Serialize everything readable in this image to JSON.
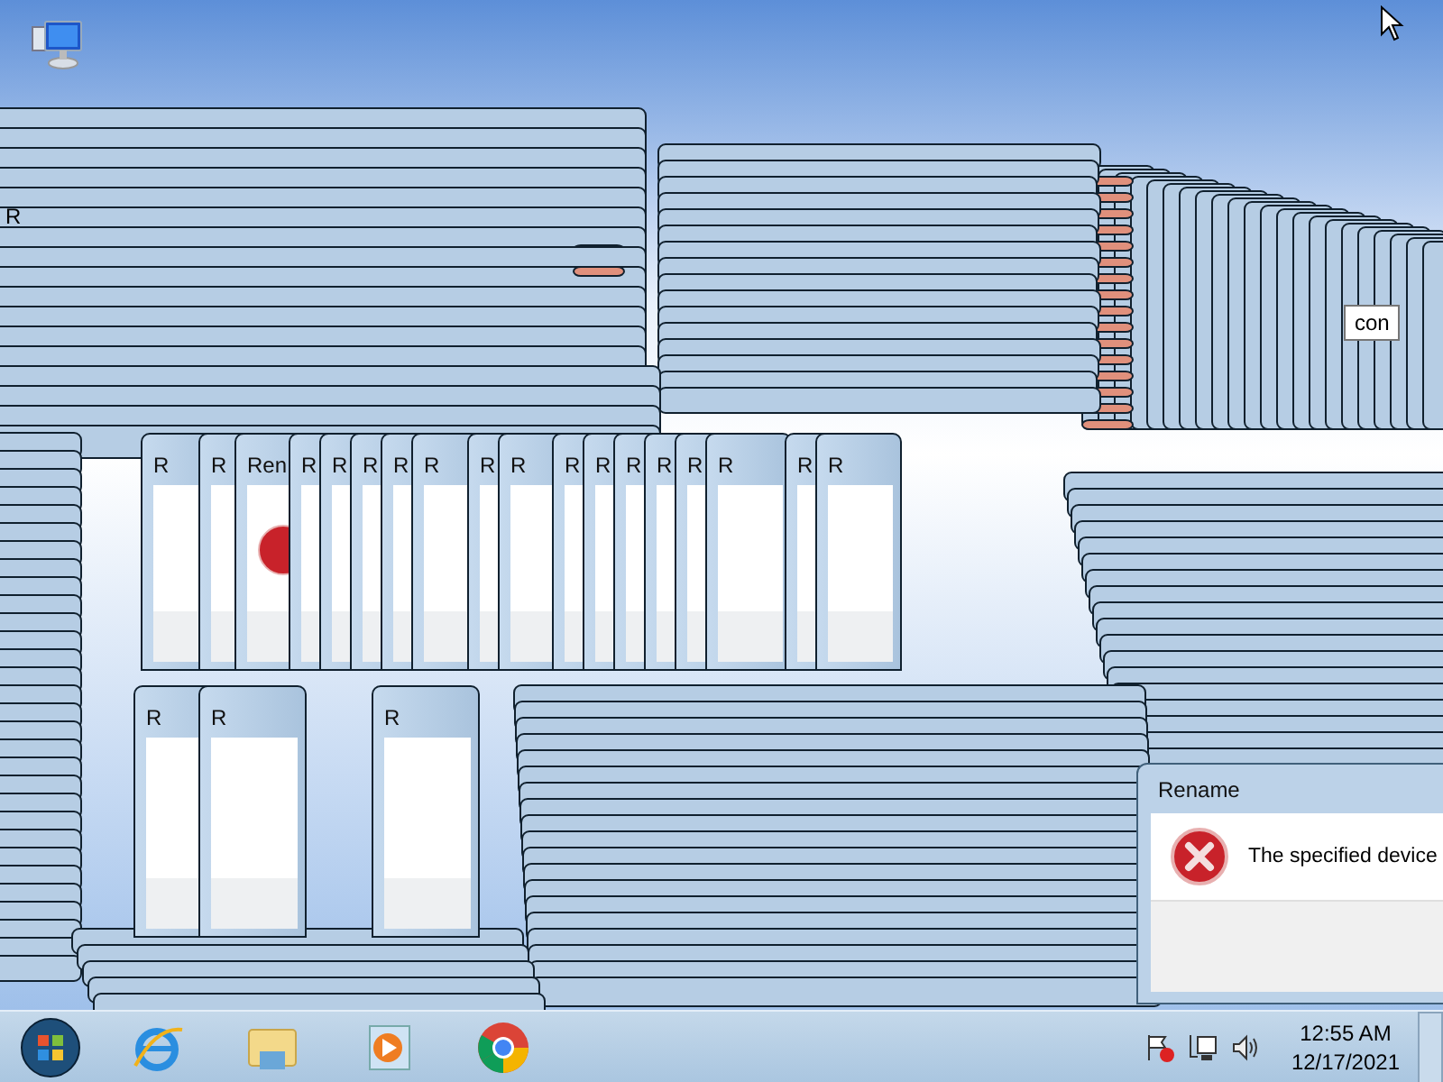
{
  "window_trail": {
    "corner_fragment": "R",
    "middle_fragments": [
      "R",
      "R",
      "Ren",
      "R",
      "R",
      "R",
      "R",
      "R",
      "R",
      "R",
      "R",
      "R",
      "R",
      "R",
      "R",
      "R",
      "R",
      "R"
    ],
    "lower_fragments": [
      "R",
      "R",
      "R"
    ]
  },
  "tooltip": {
    "text": "con"
  },
  "dialog": {
    "title": "Rename",
    "message": "The specified device"
  },
  "taskbar": {
    "clock": {
      "time": "12:55 AM",
      "date": "12/17/2021"
    }
  }
}
